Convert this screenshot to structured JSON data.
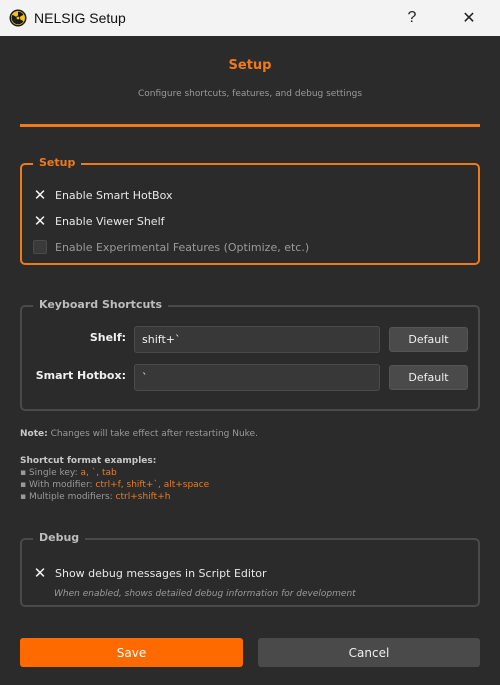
{
  "window": {
    "title": "NELSIG Setup",
    "help_glyph": "?",
    "close_glyph": "✕",
    "app_icon": "radiation-icon"
  },
  "header": {
    "title": "Setup",
    "subtitle": "Configure shortcuts, features, and debug settings"
  },
  "setup_group": {
    "legend": "Setup",
    "items": [
      {
        "label": "Enable Smart HotBox",
        "checked": true
      },
      {
        "label": "Enable Viewer Shelf",
        "checked": true
      },
      {
        "label": "Enable Experimental Features (Optimize, etc.)",
        "checked": false
      }
    ]
  },
  "shortcuts_group": {
    "legend": "Keyboard Shortcuts",
    "shelf_label": "Shelf:",
    "shelf_value": "shift+`",
    "hotbox_label": "Smart Hotbox:",
    "hotbox_value": "`",
    "default_label": "Default"
  },
  "note": {
    "prefix": "Note:",
    "text": "Changes will take effect after restarting Nuke."
  },
  "format": {
    "title": "Shortcut format examples:",
    "lines": [
      {
        "prefix": "▪ Single key: ",
        "example": "a, `, tab"
      },
      {
        "prefix": "▪ With modifier: ",
        "example": "ctrl+f, shift+`, alt+space"
      },
      {
        "prefix": "▪ Multiple modifiers: ",
        "example": "ctrl+shift+h"
      }
    ]
  },
  "debug_group": {
    "legend": "Debug",
    "checkbox_label": "Show debug messages in Script Editor",
    "checked": true,
    "description": "When enabled, shows detailed debug information for development"
  },
  "buttons": {
    "save": "Save",
    "cancel": "Cancel"
  },
  "colors": {
    "accent": "#f07a1a",
    "save_button": "#ff6a00",
    "background": "#2b2b2b"
  }
}
